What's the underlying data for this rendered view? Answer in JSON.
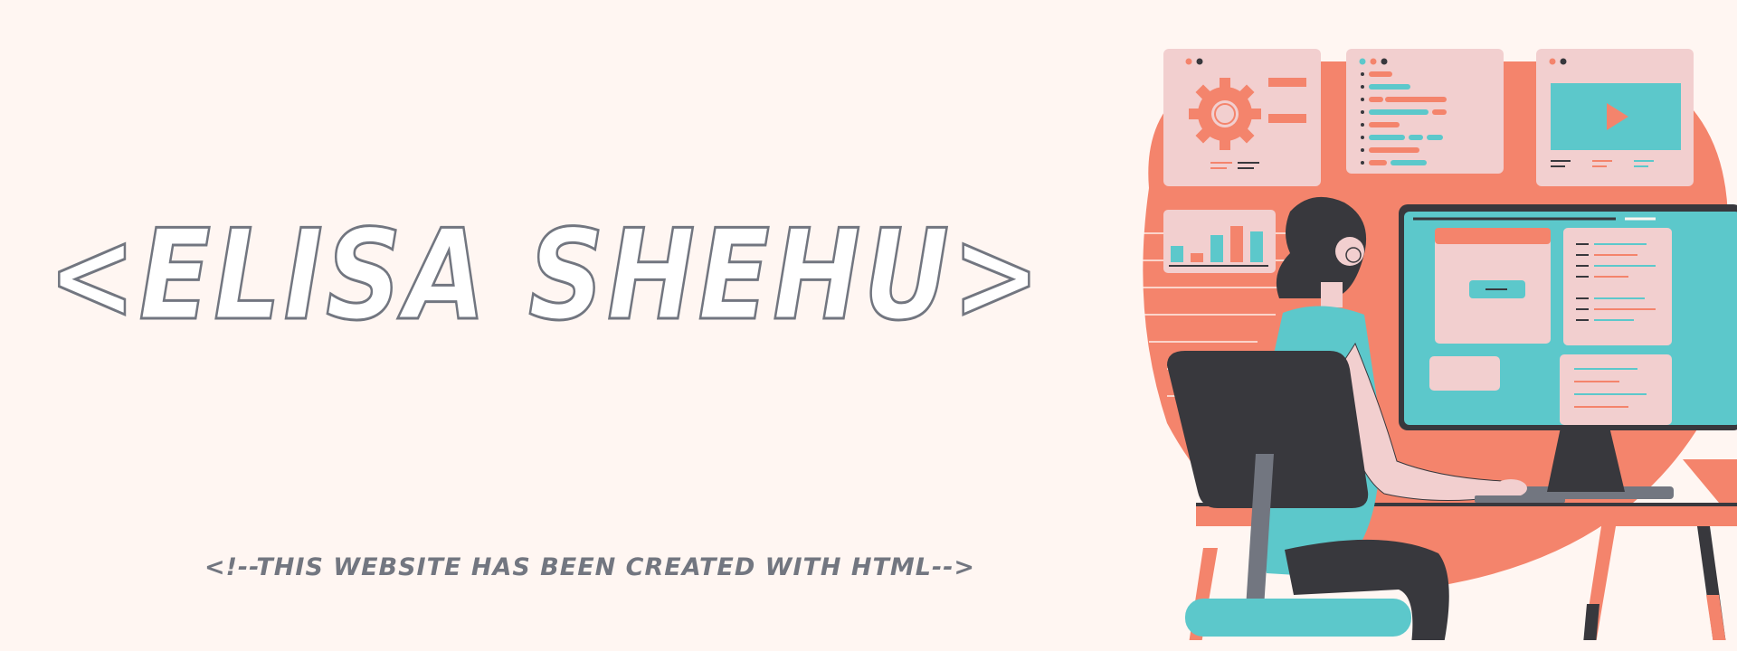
{
  "hero": {
    "title": "<ELISA SHEHU>",
    "subtitle": "<!--THIS WEBSITE HAS BEEN CREATED WITH HTML-->"
  },
  "colors": {
    "background": "#fff6f2",
    "coral": "#f4846c",
    "teal": "#5cc8cb",
    "pink": "#f2cfcf",
    "dark": "#38383d",
    "gray": "#727680"
  },
  "illustration": {
    "icons": [
      "gear-icon",
      "play-icon",
      "bar-chart-icon"
    ]
  }
}
